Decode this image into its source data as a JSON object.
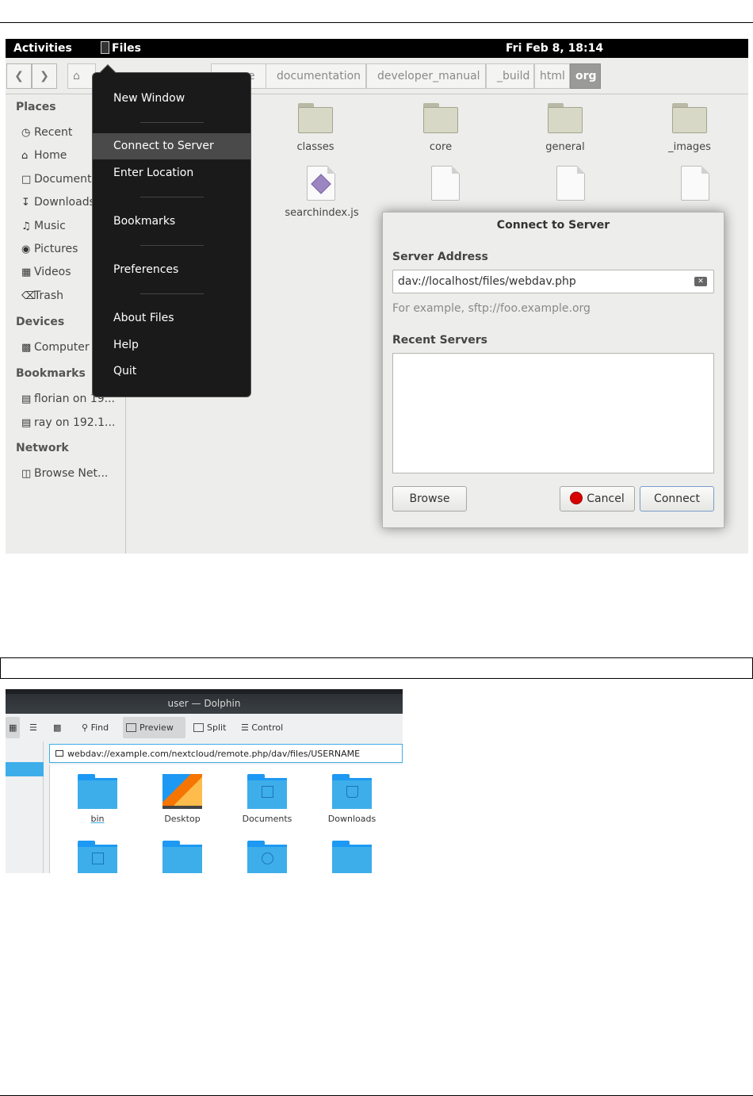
{
  "gnome": {
    "topbar": {
      "activities": "Activities",
      "app": "Files",
      "clock": "Fri Feb  8, 18:14"
    },
    "breadcrumbs": [
      "e",
      "documentation",
      "developer_manual",
      "_build",
      "html",
      "org"
    ],
    "home_crumb": "h",
    "sidebar": {
      "places_head": "Places",
      "places": [
        "Recent",
        "Home",
        "Documents",
        "Downloads",
        "Music",
        "Pictures",
        "Videos",
        "Trash"
      ],
      "devices_head": "Devices",
      "devices": [
        "Computer"
      ],
      "bookmarks_head": "Bookmarks",
      "bookmarks": [
        "florian on 19...",
        "ray on 192.1..."
      ],
      "network_head": "Network",
      "network": [
        "Browse Net..."
      ]
    },
    "files": {
      "folders": [
        "classes",
        "core",
        "general",
        "_images"
      ],
      "docs": [
        "searchindex.js"
      ]
    },
    "menu": {
      "items": [
        "New Window",
        "Connect to Server",
        "Enter Location",
        "Bookmarks",
        "Preferences",
        "About Files",
        "Help",
        "Quit"
      ]
    },
    "dialog": {
      "title": "Connect to Server",
      "server_label": "Server Address",
      "server_value": "dav://localhost/files/webdav.php",
      "hint": "For example, sftp://foo.example.org",
      "recent_label": "Recent Servers",
      "browse": "Browse",
      "cancel": "Cancel",
      "connect": "Connect"
    }
  },
  "dolphin": {
    "title": "user — Dolphin",
    "toolbar": {
      "find": "Find",
      "preview": "Preview",
      "split": "Split",
      "control": "Control"
    },
    "url": "webdav://example.com/nextcloud/remote.php/dav/files/USERNAME",
    "items": [
      "bin",
      "Desktop",
      "Documents",
      "Downloads"
    ]
  }
}
